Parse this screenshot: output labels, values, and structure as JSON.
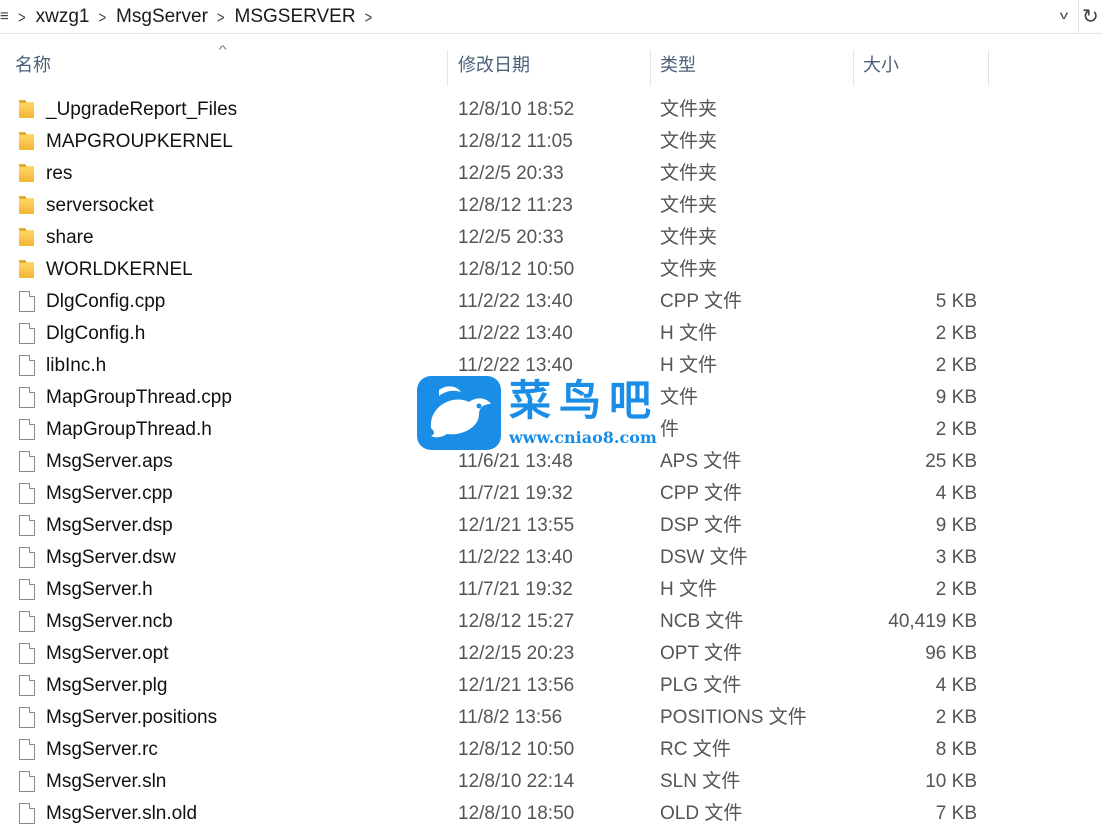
{
  "breadcrumb": {
    "items": [
      "xwzg1",
      "MsgServer",
      "MSGSERVER"
    ]
  },
  "columns": {
    "name": "名称",
    "date": "修改日期",
    "type": "类型",
    "size": "大小"
  },
  "files": [
    {
      "name": "_UpgradeReport_Files",
      "date": "12/8/10 18:52",
      "type": "文件夹",
      "size": "",
      "kind": "folder"
    },
    {
      "name": "MAPGROUPKERNEL",
      "date": "12/8/12 11:05",
      "type": "文件夹",
      "size": "",
      "kind": "folder"
    },
    {
      "name": "res",
      "date": "12/2/5 20:33",
      "type": "文件夹",
      "size": "",
      "kind": "folder"
    },
    {
      "name": "serversocket",
      "date": "12/8/12 11:23",
      "type": "文件夹",
      "size": "",
      "kind": "folder"
    },
    {
      "name": "share",
      "date": "12/2/5 20:33",
      "type": "文件夹",
      "size": "",
      "kind": "folder"
    },
    {
      "name": "WORLDKERNEL",
      "date": "12/8/12 10:50",
      "type": "文件夹",
      "size": "",
      "kind": "folder"
    },
    {
      "name": "DlgConfig.cpp",
      "date": "11/2/22 13:40",
      "type": "CPP 文件",
      "size": "5 KB",
      "kind": "file"
    },
    {
      "name": "DlgConfig.h",
      "date": "11/2/22 13:40",
      "type": "H 文件",
      "size": "2 KB",
      "kind": "file"
    },
    {
      "name": "libInc.h",
      "date": "11/2/22 13:40",
      "type": "H 文件",
      "size": "2 KB",
      "kind": "file"
    },
    {
      "name": "MapGroupThread.cpp",
      "date": "",
      "type": "文件",
      "size": "9 KB",
      "kind": "file"
    },
    {
      "name": "MapGroupThread.h",
      "date": "",
      "type": "件",
      "size": "2 KB",
      "kind": "file"
    },
    {
      "name": "MsgServer.aps",
      "date": "11/6/21 13:48",
      "type": "APS 文件",
      "size": "25 KB",
      "kind": "file"
    },
    {
      "name": "MsgServer.cpp",
      "date": "11/7/21 19:32",
      "type": "CPP 文件",
      "size": "4 KB",
      "kind": "file"
    },
    {
      "name": "MsgServer.dsp",
      "date": "12/1/21 13:55",
      "type": "DSP 文件",
      "size": "9 KB",
      "kind": "file"
    },
    {
      "name": "MsgServer.dsw",
      "date": "11/2/22 13:40",
      "type": "DSW 文件",
      "size": "3 KB",
      "kind": "file"
    },
    {
      "name": "MsgServer.h",
      "date": "11/7/21 19:32",
      "type": "H 文件",
      "size": "2 KB",
      "kind": "file"
    },
    {
      "name": "MsgServer.ncb",
      "date": "12/8/12 15:27",
      "type": "NCB 文件",
      "size": "40,419 KB",
      "kind": "file"
    },
    {
      "name": "MsgServer.opt",
      "date": "12/2/15 20:23",
      "type": "OPT 文件",
      "size": "96 KB",
      "kind": "file"
    },
    {
      "name": "MsgServer.plg",
      "date": "12/1/21 13:56",
      "type": "PLG 文件",
      "size": "4 KB",
      "kind": "file"
    },
    {
      "name": "MsgServer.positions",
      "date": "11/8/2 13:56",
      "type": "POSITIONS 文件",
      "size": "2 KB",
      "kind": "file"
    },
    {
      "name": "MsgServer.rc",
      "date": "12/8/12 10:50",
      "type": "RC 文件",
      "size": "8 KB",
      "kind": "file"
    },
    {
      "name": "MsgServer.sln",
      "date": "12/8/10 22:14",
      "type": "SLN 文件",
      "size": "10 KB",
      "kind": "file"
    },
    {
      "name": "MsgServer.sln.old",
      "date": "12/8/10 18:50",
      "type": "OLD 文件",
      "size": "7 KB",
      "kind": "file"
    }
  ],
  "watermark": {
    "title": "菜鸟吧",
    "url": "www.cniao8.com"
  },
  "colors": {
    "header_text": "#4c607a",
    "watermark_blue": "#1a8ee6",
    "folder_yellow": "#f4b533"
  },
  "icons": {
    "folder": "folder-icon",
    "file": "file-icon",
    "refresh": "refresh-icon",
    "dropdown": "chevron-down-icon"
  }
}
